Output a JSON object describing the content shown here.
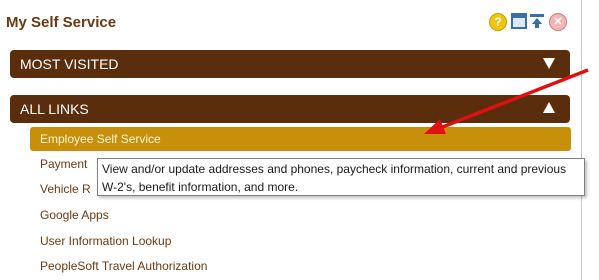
{
  "panel": {
    "title": "My Self Service",
    "icons": [
      "help-icon",
      "window-icon",
      "collapse-icon",
      "close-icon"
    ]
  },
  "sections": {
    "most_visited": {
      "label": "MOST VISITED",
      "state": "collapsed"
    },
    "all_links": {
      "label": "ALL LINKS",
      "state": "expanded"
    }
  },
  "links": [
    {
      "label": "Employee Self Service",
      "selected": true
    },
    {
      "label": "Payment",
      "selected": false
    },
    {
      "label": "Vehicle R",
      "selected": false
    },
    {
      "label": "Google Apps",
      "selected": false
    },
    {
      "label": "User Information Lookup",
      "selected": false
    },
    {
      "label": "PeopleSoft Travel Authorization",
      "selected": false
    }
  ],
  "tooltip": {
    "text": "View and/or update addresses and phones, paycheck information, current and previous\nW-2's, benefit information, and more."
  },
  "colors": {
    "bar_background": "#5a2d0c",
    "selected_link": "#c8900a",
    "link_text": "#6b3a10",
    "annotation_arrow": "#e01010"
  }
}
